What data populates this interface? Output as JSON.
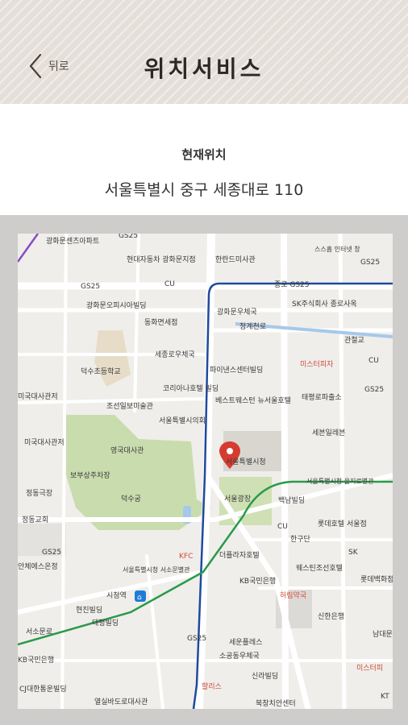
{
  "header": {
    "back_label": "뒤로",
    "title": "위치서비스"
  },
  "location": {
    "label": "현재위치",
    "address": "서울특별시 중구 세종대로 110"
  },
  "map": {
    "labels": {
      "gwanghwamun_apt": "광화문센츠아파트",
      "hyundai": "현대자동차 광화문지점",
      "sanhe": "한란드미사관",
      "gs25_top": "GS25",
      "starbucks": "스스흠 인터넷 창",
      "gs25_tr": "GS25",
      "jongno_gs25": "종로 GS25",
      "gs25_l": "GS25",
      "cu_top": "CU",
      "gwanghwamun_office": "광화문오피시아빌딩",
      "gwanghwamun_post": "광화문우체국",
      "sk": "SK주식회사 종로사옥",
      "cheonggyecheon": "청계천로",
      "gwancheolgyo": "관철교",
      "dongwha": "동화면세점",
      "sejong_post": "세종로우체국",
      "finance_center": "파이낸스센터빌딩",
      "mister_pizza": "미스터피자",
      "cu_right": "CU",
      "deoksu_school": "덕수초등학교",
      "corea_hotel": "코리아나호텔 빌딩",
      "best_western": "베스트웨스턴 뉴서울호텔",
      "taepyeong": "태평로파출소",
      "gs25_r": "GS25",
      "ambassador": "미국대사관저",
      "chosun": "조선일보미술관",
      "seoul_hall": "서울특별시의회",
      "naver": "세븐일레븐",
      "embassy_left": "미국대사관저",
      "yeonggug": "영국대사관",
      "city_hall": "서울특별시청",
      "heritage": "보부상주차장",
      "deoksugung": "덕수궁",
      "seoul_plaza": "서울광장",
      "euljiro": "서울특별시청 을지로별관",
      "jeongdong": "정동극장",
      "baekim": "백남빌딩",
      "jeongdong_church": "정동교회",
      "cu_mid": "CU",
      "hangu": "한구단",
      "lotte_hotel": "롯데호텔 서울점",
      "gs25_ml": "GS25",
      "kfc": "KFC",
      "deurim": "더플라자호텔",
      "westin": "웨스틴조선호텔",
      "sk_br": "SK",
      "lotte_dept": "롯데백화점",
      "seosomun": "서울특별시청 서소문별관",
      "kb": "KB국민은행",
      "heorim": "허림약국",
      "city_station": "시청역",
      "hyeonjin": "현진빌딩",
      "taepyeong_bld": "태평빌딩",
      "shinhan": "신한은행",
      "seosomunro": "서소문로",
      "namdaemunro": "남대문로",
      "gs25_bl": "GS25",
      "sejong_center": "세운플레스",
      "sogong": "소공동우체국",
      "kb_left": "KB국민은행",
      "shinhan_bld": "신라빌딩",
      "mister_pizza2": "미스터피",
      "cj": "CJ대한통운빌딩",
      "hollys": "할리스",
      "kt": "KT",
      "yeolsil": "열실바도로대사관",
      "bukchang": "북창치안센터",
      "anche": "안체에스온정"
    }
  }
}
